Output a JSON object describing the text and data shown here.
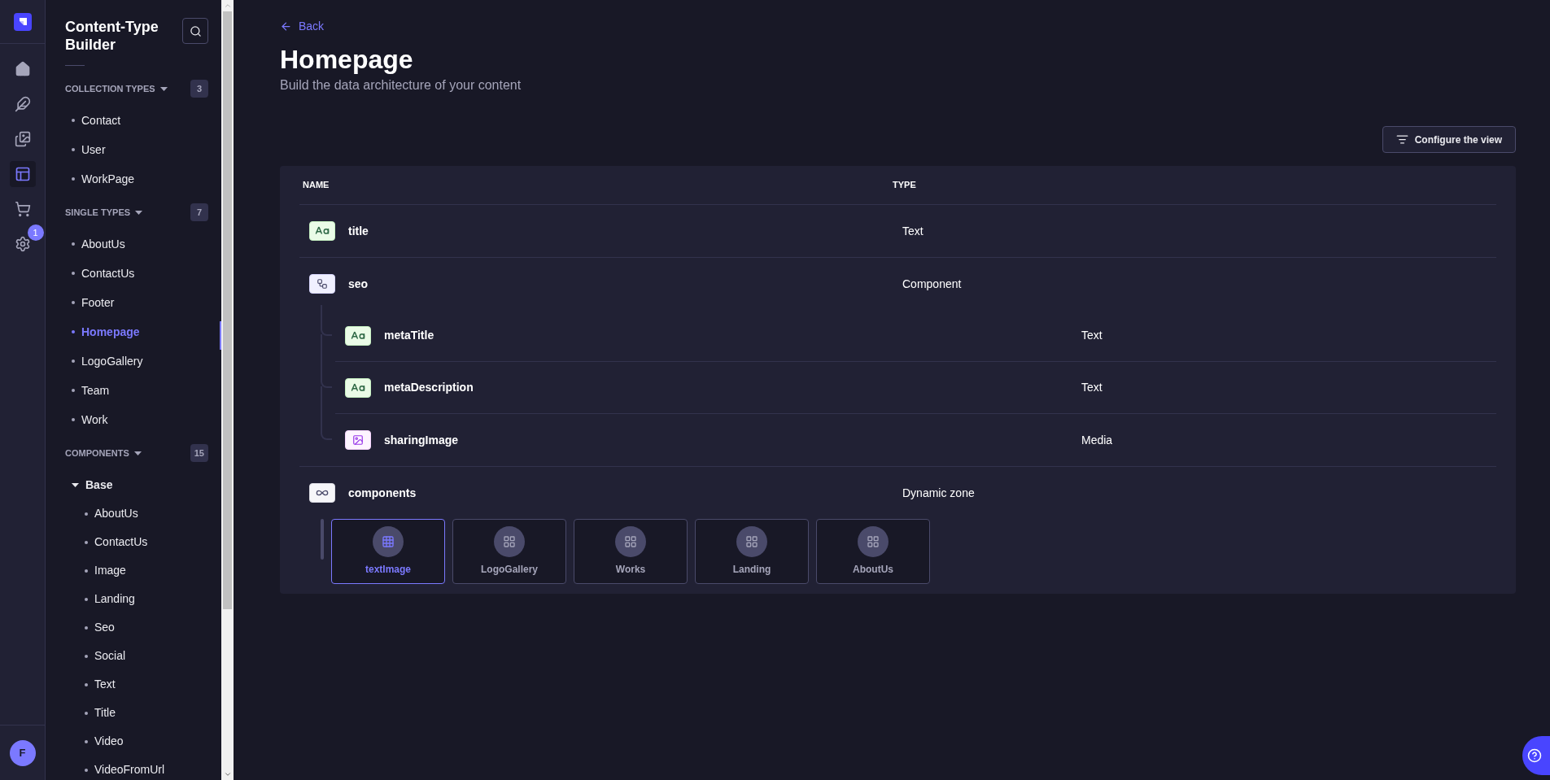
{
  "rail": {
    "items": [
      {
        "kind": "home",
        "selected": false
      },
      {
        "kind": "feather",
        "selected": false
      },
      {
        "kind": "media",
        "selected": false
      },
      {
        "kind": "builder",
        "selected": true
      },
      {
        "kind": "cart",
        "selected": false
      },
      {
        "kind": "settings",
        "selected": false,
        "badge": "1"
      }
    ],
    "avatar": "F"
  },
  "sidebar": {
    "title": "Content-Type Builder",
    "sections": [
      {
        "label": "COLLECTION TYPES",
        "count": "3",
        "items": [
          {
            "label": "Contact",
            "selected": false
          },
          {
            "label": "User",
            "selected": false
          },
          {
            "label": "WorkPage",
            "selected": false
          }
        ]
      },
      {
        "label": "SINGLE TYPES",
        "count": "7",
        "items": [
          {
            "label": "AboutUs",
            "selected": false
          },
          {
            "label": "ContactUs",
            "selected": false
          },
          {
            "label": "Footer",
            "selected": false
          },
          {
            "label": "Homepage",
            "selected": true
          },
          {
            "label": "LogoGallery",
            "selected": false
          },
          {
            "label": "Team",
            "selected": false
          },
          {
            "label": "Work",
            "selected": false
          }
        ]
      },
      {
        "label": "COMPONENTS",
        "count": "15",
        "items": [
          {
            "label": "Base",
            "expanded": true,
            "children": [
              {
                "label": "AboutUs",
                "selected": false
              },
              {
                "label": "ContactUs",
                "selected": false
              },
              {
                "label": "Image",
                "selected": false
              },
              {
                "label": "Landing",
                "selected": false
              },
              {
                "label": "Seo",
                "selected": false
              },
              {
                "label": "Social",
                "selected": false
              },
              {
                "label": "Text",
                "selected": false
              },
              {
                "label": "Title",
                "selected": false
              },
              {
                "label": "Video",
                "selected": false
              },
              {
                "label": "VideoFromUrl",
                "selected": false
              }
            ]
          }
        ]
      }
    ]
  },
  "main": {
    "back": "Back",
    "title": "Homepage",
    "subtitle": "Build the data architecture of your content",
    "configure_button": "Configure the view",
    "table": {
      "columns": [
        "NAME",
        "TYPE"
      ],
      "rows": [
        {
          "name": "title",
          "type": "Text",
          "kind": "text"
        },
        {
          "name": "seo",
          "type": "Component",
          "kind": "component",
          "children": [
            {
              "name": "metaTitle",
              "type": "Text",
              "kind": "text"
            },
            {
              "name": "metaDescription",
              "type": "Text",
              "kind": "text"
            },
            {
              "name": "sharingImage",
              "type": "Media",
              "kind": "media"
            }
          ]
        },
        {
          "name": "components",
          "type": "Dynamic zone",
          "kind": "dynamic_zone",
          "components": [
            {
              "label": "textImage",
              "selected": true
            },
            {
              "label": "LogoGallery",
              "selected": false
            },
            {
              "label": "Works",
              "selected": false
            },
            {
              "label": "Landing",
              "selected": false
            },
            {
              "label": "AboutUs",
              "selected": false
            }
          ]
        }
      ]
    }
  }
}
